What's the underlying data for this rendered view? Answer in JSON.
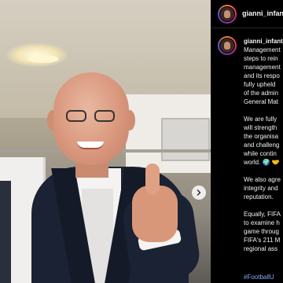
{
  "post": {
    "username": "gianni_infantino",
    "caption_username": "gianni_infantino",
    "caption_paragraphs": [
      [
        "Management",
        "steps to rein",
        "management",
        "and its respo",
        "fully upheld",
        "of the admin",
        "General Mat"
      ],
      [
        "We are fully",
        "will strength",
        "the organisa",
        "and challeng",
        "while contin",
        "world. 🌍 🤝"
      ],
      [
        "We also agre",
        "integrity and",
        "reputation."
      ],
      [
        "Equally, FIFA",
        "to examine h",
        "game throug",
        "FIFA's 211 M",
        "regional ass"
      ]
    ],
    "hashtag": "#FootballU"
  },
  "icons": {
    "carousel_next": "chevron-right-icon",
    "avatar_ring": "story-ring"
  },
  "colors": {
    "background": "#000000",
    "text": "#f5f5f5",
    "hashtag": "#8aa7ff"
  }
}
